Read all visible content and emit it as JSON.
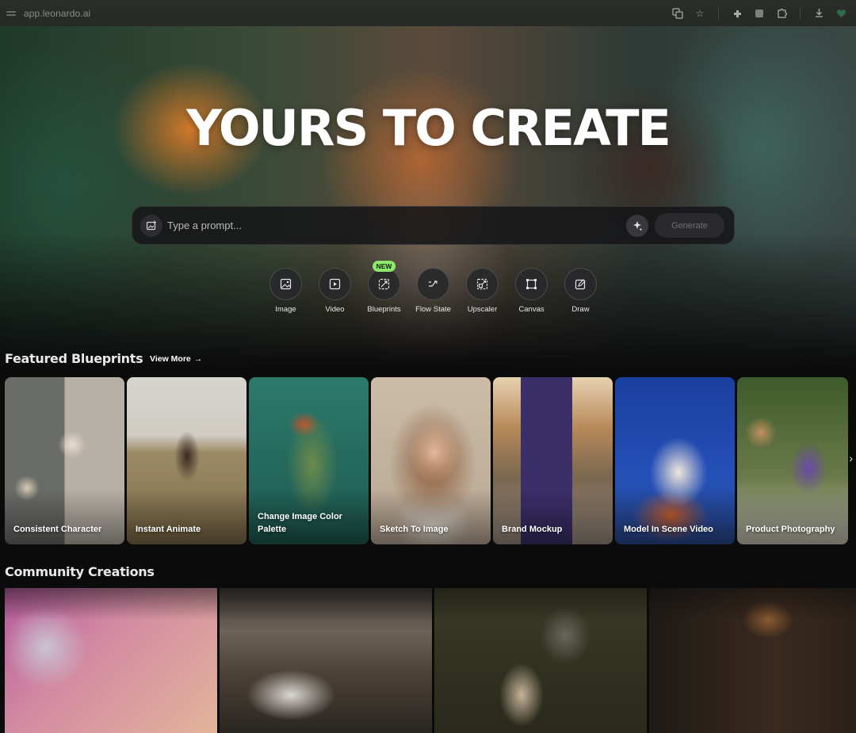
{
  "browser": {
    "url": "app.leonardo.ai"
  },
  "hero": {
    "title": "YOURS TO CREATE",
    "prompt_placeholder": "Type a prompt...",
    "generate_label": "Generate",
    "tools": [
      {
        "label": "Image",
        "icon": "image-icon"
      },
      {
        "label": "Video",
        "icon": "video-icon"
      },
      {
        "label": "Blueprints",
        "icon": "blueprints-icon",
        "badge": "NEW"
      },
      {
        "label": "Flow State",
        "icon": "flow-state-icon"
      },
      {
        "label": "Upscaler",
        "icon": "upscaler-icon"
      },
      {
        "label": "Canvas",
        "icon": "canvas-icon"
      },
      {
        "label": "Draw",
        "icon": "draw-icon"
      }
    ]
  },
  "featured": {
    "title": "Featured Blueprints",
    "view_more": "View More",
    "cards": [
      {
        "label": "Consistent Character"
      },
      {
        "label": "Instant Animate"
      },
      {
        "label": "Change Image Color Palette"
      },
      {
        "label": "Sketch To Image"
      },
      {
        "label": "Brand Mockup"
      },
      {
        "label": "Model In Scene Video"
      },
      {
        "label": "Product Photography"
      }
    ]
  },
  "community": {
    "title": "Community Creations"
  },
  "colors": {
    "badge": "#8ee86b",
    "background": "#0b0b0c"
  }
}
